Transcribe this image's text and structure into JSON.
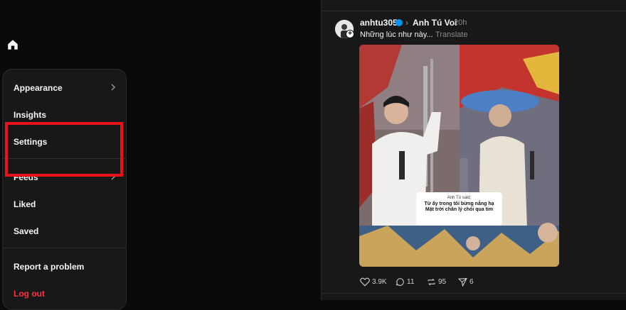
{
  "menu": {
    "appearance": "Appearance",
    "insights": "Insights",
    "settings": "Settings",
    "feeds": "Feeds",
    "liked": "Liked",
    "saved": "Saved",
    "report": "Report a problem",
    "logout": "Log out"
  },
  "post": {
    "username": "anhtu305",
    "community": "Anh Tú Voi",
    "time": "20h",
    "caption": "Những lúc như này...",
    "translate": "Translate",
    "quote": {
      "line1": "Anh Tú said:",
      "line2": "Từ ấy trong tôi bừng nắng hạ",
      "line3": "Mặt trời chân lý chói qua tim"
    },
    "actions": {
      "likes": "3.9K",
      "comments": "11",
      "reposts": "95",
      "shares": "6"
    }
  },
  "colors": {
    "highlight": "#e8131a",
    "logout": "#ff3040",
    "verified": "#0095f6"
  }
}
